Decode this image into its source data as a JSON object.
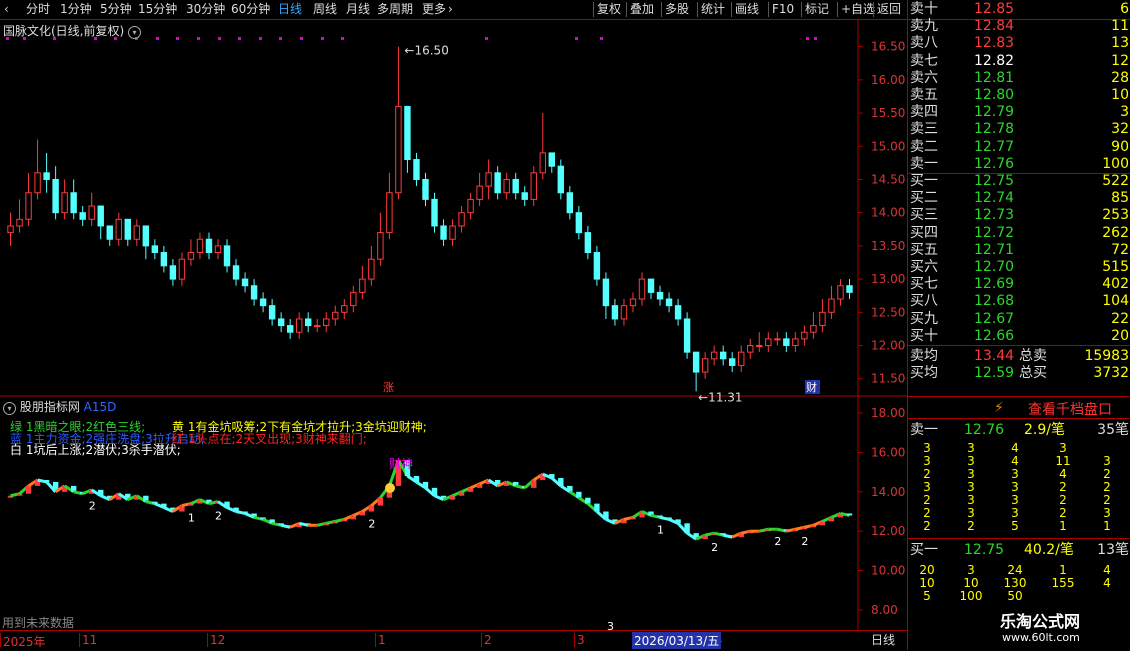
{
  "toolbar": {
    "periods": [
      "分时",
      "1分钟",
      "5分钟",
      "15分钟",
      "30分钟",
      "60分钟",
      "日线",
      "周线",
      "月线",
      "多周期",
      "更多"
    ],
    "active_period": "日线",
    "more_icon": "chevron-right-icon",
    "actions": [
      "复权",
      "叠加",
      "多股",
      "统计",
      "画线",
      "F10",
      "标记",
      "+自选",
      "返回"
    ]
  },
  "main_chart": {
    "title": "国脉文化(日线,前复权)",
    "max_label": "16.50",
    "min_label": "11.31",
    "zhang_label": "涨",
    "cai_label": "财",
    "price_axis": [
      "16.50",
      "16.00",
      "15.50",
      "15.00",
      "14.50",
      "14.00",
      "13.50",
      "13.00",
      "12.50",
      "12.00",
      "11.50"
    ],
    "up_color": "#ff3b3b",
    "down_color": "#54ffff"
  },
  "chart_data": {
    "type": "candlestick",
    "open": [
      13.7,
      13.8,
      13.9,
      14.3,
      14.6,
      14.5,
      14.0,
      14.3,
      14.0,
      13.9,
      14.1,
      13.8,
      13.6,
      13.9,
      13.6,
      13.8,
      13.5,
      13.4,
      13.2,
      13.0,
      13.3,
      13.4,
      13.6,
      13.4,
      13.5,
      13.2,
      13.0,
      12.9,
      12.7,
      12.6,
      12.4,
      12.3,
      12.2,
      12.4,
      12.3,
      12.3,
      12.4,
      12.5,
      12.6,
      12.8,
      13.0,
      13.3,
      13.7,
      14.3,
      15.6,
      14.8,
      14.5,
      14.2,
      13.8,
      13.6,
      13.8,
      14.0,
      14.2,
      14.4,
      14.6,
      14.3,
      14.5,
      14.3,
      14.2,
      14.6,
      14.9,
      14.7,
      14.3,
      14.0,
      13.7,
      13.4,
      13.0,
      12.6,
      12.4,
      12.6,
      12.7,
      13.0,
      12.8,
      12.7,
      12.6,
      12.4,
      11.9,
      11.6,
      11.8,
      11.9,
      11.8,
      11.7,
      11.9,
      12.0,
      12.0,
      12.1,
      12.1,
      12.0,
      12.1,
      12.2,
      12.3,
      12.5,
      12.7,
      12.9
    ],
    "close": [
      13.8,
      13.9,
      14.3,
      14.6,
      14.5,
      14.0,
      14.3,
      14.0,
      13.9,
      14.1,
      13.8,
      13.6,
      13.9,
      13.6,
      13.8,
      13.5,
      13.4,
      13.2,
      13.0,
      13.3,
      13.4,
      13.6,
      13.4,
      13.5,
      13.2,
      13.0,
      12.9,
      12.7,
      12.6,
      12.4,
      12.3,
      12.2,
      12.4,
      12.3,
      12.3,
      12.4,
      12.5,
      12.6,
      12.8,
      13.0,
      13.3,
      13.7,
      14.3,
      15.6,
      14.8,
      14.5,
      14.2,
      13.8,
      13.6,
      13.8,
      14.0,
      14.2,
      14.4,
      14.6,
      14.3,
      14.5,
      14.3,
      14.2,
      14.6,
      14.9,
      14.7,
      14.3,
      14.0,
      13.7,
      13.4,
      13.0,
      12.6,
      12.4,
      12.6,
      12.7,
      13.0,
      12.8,
      12.7,
      12.6,
      12.4,
      11.9,
      11.6,
      11.8,
      11.9,
      11.8,
      11.7,
      11.9,
      12.0,
      12.0,
      12.1,
      12.1,
      12.0,
      12.1,
      12.2,
      12.3,
      12.5,
      12.7,
      12.9,
      12.8
    ],
    "high": [
      14.0,
      14.2,
      14.6,
      15.1,
      14.9,
      14.7,
      14.5,
      14.5,
      14.1,
      14.3,
      14.0,
      13.8,
      14.0,
      13.9,
      13.9,
      13.8,
      13.6,
      13.5,
      13.3,
      13.4,
      13.6,
      13.7,
      13.7,
      13.6,
      13.6,
      13.3,
      13.1,
      13.0,
      12.8,
      12.7,
      12.5,
      12.4,
      12.5,
      12.5,
      12.4,
      12.5,
      12.6,
      12.7,
      12.9,
      13.2,
      13.5,
      14.0,
      14.6,
      16.5,
      15.6,
      14.9,
      14.6,
      14.3,
      13.9,
      13.9,
      14.1,
      14.3,
      14.6,
      14.8,
      14.7,
      14.6,
      14.6,
      14.4,
      14.7,
      15.5,
      14.9,
      14.8,
      14.4,
      14.1,
      13.8,
      13.5,
      13.1,
      12.7,
      12.7,
      12.8,
      13.1,
      13.0,
      12.9,
      12.8,
      12.7,
      12.5,
      11.9,
      11.9,
      12.0,
      12.0,
      11.9,
      12.0,
      12.1,
      12.2,
      12.2,
      12.2,
      12.2,
      12.2,
      12.3,
      12.5,
      12.7,
      12.9,
      13.0,
      13.0
    ],
    "low": [
      13.5,
      13.7,
      13.8,
      14.2,
      14.3,
      13.9,
      13.9,
      13.9,
      13.8,
      13.8,
      13.6,
      13.5,
      13.5,
      13.5,
      13.5,
      13.3,
      13.3,
      13.1,
      12.9,
      12.9,
      13.2,
      13.3,
      13.3,
      13.3,
      13.1,
      12.9,
      12.8,
      12.6,
      12.5,
      12.3,
      12.2,
      12.1,
      12.1,
      12.2,
      12.2,
      12.2,
      12.3,
      12.4,
      12.5,
      12.7,
      12.9,
      13.2,
      13.6,
      14.2,
      14.6,
      14.4,
      14.1,
      13.7,
      13.5,
      13.5,
      13.7,
      13.9,
      14.1,
      14.2,
      14.2,
      14.2,
      14.2,
      14.1,
      14.1,
      14.5,
      14.6,
      14.2,
      13.9,
      13.6,
      13.3,
      12.9,
      12.4,
      12.3,
      12.3,
      12.5,
      12.6,
      12.7,
      12.6,
      12.5,
      12.3,
      11.8,
      11.31,
      11.5,
      11.7,
      11.7,
      11.6,
      11.6,
      11.8,
      11.9,
      11.9,
      12.0,
      11.9,
      11.9,
      12.0,
      12.1,
      12.2,
      12.4,
      12.6,
      12.7
    ],
    "ylim": [
      11.3,
      16.6
    ],
    "indicator_ylim": [
      8.0,
      18.0
    ]
  },
  "indicator": {
    "title": "股朋指标网",
    "code": "A15D",
    "axis": [
      "18.00",
      "16.00",
      "14.00",
      "12.00",
      "10.00",
      "8.00"
    ],
    "legend_green": "绿 1黑暗之眼;2红色三线;",
    "legend_blue": "蓝 1主力资金;2强庄洗盘;3拉升启动;",
    "legend_white": "白 1坑后上涨;2潜伏;3杀手潜伏;",
    "legend_yellow": "黄 1有金坑吸筹;2下有金坑才拉升;3金坑迎财神;",
    "legend_red": "红 1头点在;2天叉出现;3财神来翻门;",
    "caishen_label": "财神",
    "marks": [
      "2",
      "1",
      "2",
      "2",
      "1",
      "2",
      "2",
      "2"
    ],
    "future_note": "用到未来数据"
  },
  "date_axis": {
    "labels": [
      "2025年",
      "11",
      "12",
      "1",
      "2",
      "3",
      "4"
    ],
    "cursor_date": "2026/03/13/五",
    "three_label": "3",
    "period": "日线"
  },
  "order_book": {
    "sell": [
      {
        "label": "卖十",
        "price": "12.85",
        "qty": "6",
        "color": "#ff3b3b"
      },
      {
        "label": "卖九",
        "price": "12.84",
        "qty": "11",
        "color": "#ff3b3b"
      },
      {
        "label": "卖八",
        "price": "12.83",
        "qty": "13",
        "color": "#ff3b3b"
      },
      {
        "label": "卖七",
        "price": "12.82",
        "qty": "12",
        "color": "#ffffff"
      },
      {
        "label": "卖六",
        "price": "12.81",
        "qty": "28",
        "color": "#2dd52d"
      },
      {
        "label": "卖五",
        "price": "12.80",
        "qty": "10",
        "color": "#2dd52d"
      },
      {
        "label": "卖四",
        "price": "12.79",
        "qty": "3",
        "color": "#2dd52d"
      },
      {
        "label": "卖三",
        "price": "12.78",
        "qty": "32",
        "color": "#2dd52d"
      },
      {
        "label": "卖二",
        "price": "12.77",
        "qty": "90",
        "color": "#2dd52d"
      },
      {
        "label": "卖一",
        "price": "12.76",
        "qty": "100",
        "color": "#2dd52d"
      }
    ],
    "buy": [
      {
        "label": "买一",
        "price": "12.75",
        "qty": "522",
        "color": "#2dd52d"
      },
      {
        "label": "买二",
        "price": "12.74",
        "qty": "85",
        "color": "#2dd52d"
      },
      {
        "label": "买三",
        "price": "12.73",
        "qty": "253",
        "color": "#2dd52d"
      },
      {
        "label": "买四",
        "price": "12.72",
        "qty": "262",
        "color": "#2dd52d"
      },
      {
        "label": "买五",
        "price": "12.71",
        "qty": "72",
        "color": "#2dd52d"
      },
      {
        "label": "买六",
        "price": "12.70",
        "qty": "515",
        "color": "#2dd52d"
      },
      {
        "label": "买七",
        "price": "12.69",
        "qty": "402",
        "color": "#2dd52d"
      },
      {
        "label": "买八",
        "price": "12.68",
        "qty": "104",
        "color": "#2dd52d"
      },
      {
        "label": "买九",
        "price": "12.67",
        "qty": "22",
        "color": "#2dd52d"
      },
      {
        "label": "买十",
        "price": "12.66",
        "qty": "20",
        "color": "#2dd52d"
      }
    ],
    "sell_avg_label": "卖均",
    "sell_avg": "13.44",
    "total_sell_label": "总卖",
    "total_sell": "15983",
    "buy_avg_label": "买均",
    "buy_avg": "12.59",
    "total_buy_label": "总买",
    "total_buy": "3732"
  },
  "depth_panel": {
    "button": "查看千档盘口",
    "bolt_icon": "lightning-icon",
    "sell1_label": "卖一",
    "sell1_price": "12.76",
    "sell1_avg": "2.9/笔",
    "sell1_count": "35笔",
    "sell1_grid": [
      [
        "3",
        "3",
        "4",
        "3"
      ],
      [
        "3",
        "3",
        "4",
        "11",
        "3"
      ],
      [
        "2",
        "3",
        "3",
        "4",
        "2"
      ],
      [
        "3",
        "3",
        "3",
        "2",
        "2"
      ],
      [
        "2",
        "3",
        "3",
        "2",
        "2"
      ],
      [
        "2",
        "3",
        "3",
        "2",
        "3"
      ],
      [
        "2",
        "2",
        "5",
        "1",
        "1"
      ]
    ],
    "buy1_label": "买一",
    "buy1_price": "12.75",
    "buy1_avg": "40.2/笔",
    "buy1_count": "13笔",
    "buy1_grid": [
      [
        "20",
        "3",
        "24",
        "1",
        "4"
      ],
      [
        "10",
        "10",
        "130",
        "155",
        "4"
      ],
      [
        "5",
        "100",
        "50"
      ]
    ]
  },
  "watermark": {
    "title": "乐淘公式网",
    "url": "www.60lt.com"
  }
}
